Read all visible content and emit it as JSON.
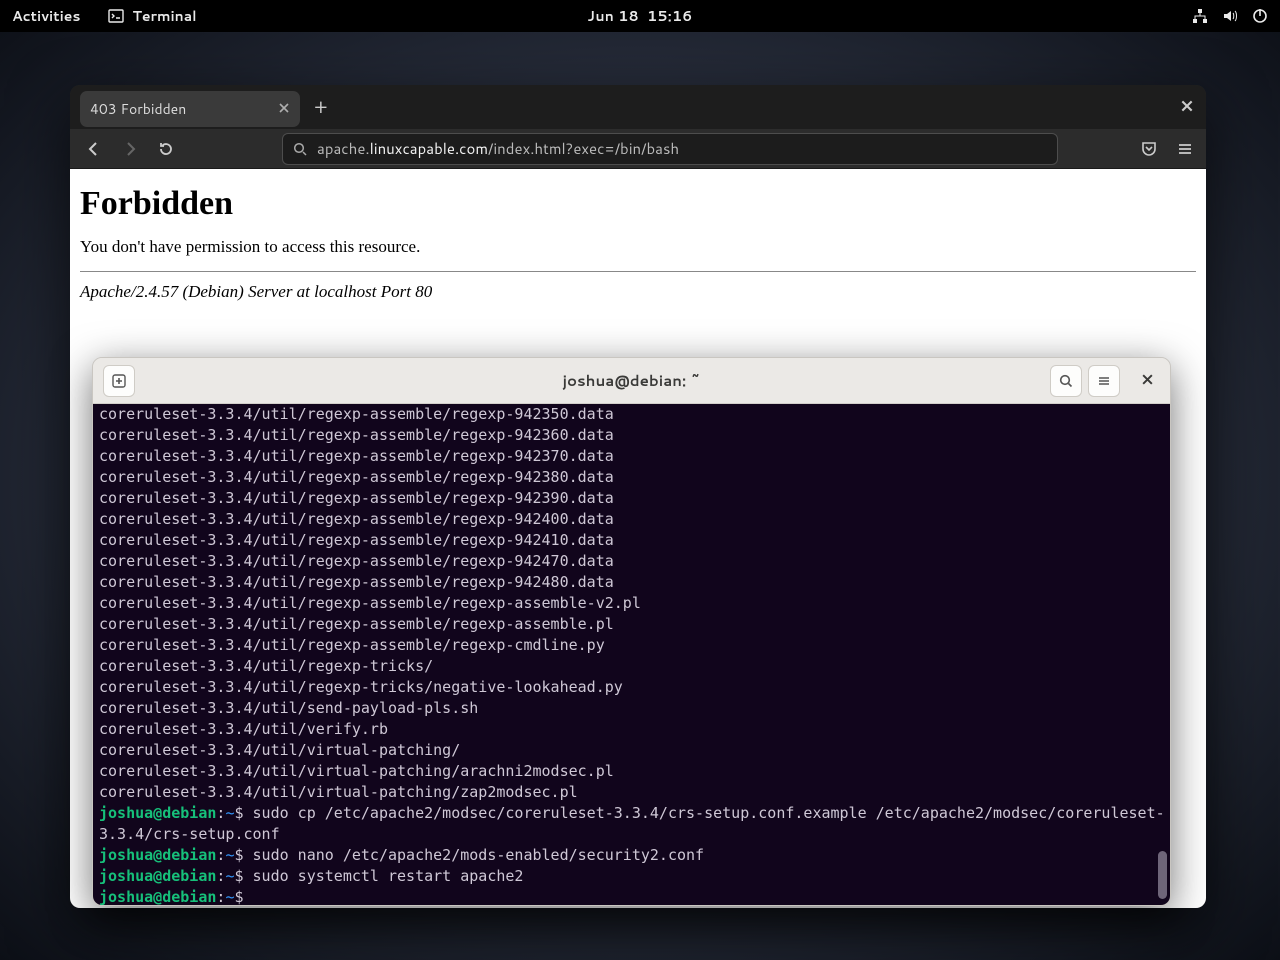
{
  "topbar": {
    "activities": "Activities",
    "app": "Terminal",
    "clock": "Jun 18  15:16"
  },
  "browser": {
    "tab_title": "403 Forbidden",
    "url_prefix": "apache.",
    "url_domain": "linuxcapable.com",
    "url_suffix": "/index.html?exec=/bin/bash",
    "page": {
      "heading": "Forbidden",
      "message": "You don't have permission to access this resource.",
      "signature": "Apache/2.4.57 (Debian) Server at localhost Port 80"
    }
  },
  "terminal": {
    "title": "joshua@debian: ~",
    "prompt_user": "joshua@debian",
    "prompt_path": "~",
    "output_lines": [
      "coreruleset-3.3.4/util/regexp-assemble/regexp-942350.data",
      "coreruleset-3.3.4/util/regexp-assemble/regexp-942360.data",
      "coreruleset-3.3.4/util/regexp-assemble/regexp-942370.data",
      "coreruleset-3.3.4/util/regexp-assemble/regexp-942380.data",
      "coreruleset-3.3.4/util/regexp-assemble/regexp-942390.data",
      "coreruleset-3.3.4/util/regexp-assemble/regexp-942400.data",
      "coreruleset-3.3.4/util/regexp-assemble/regexp-942410.data",
      "coreruleset-3.3.4/util/regexp-assemble/regexp-942470.data",
      "coreruleset-3.3.4/util/regexp-assemble/regexp-942480.data",
      "coreruleset-3.3.4/util/regexp-assemble/regexp-assemble-v2.pl",
      "coreruleset-3.3.4/util/regexp-assemble/regexp-assemble.pl",
      "coreruleset-3.3.4/util/regexp-assemble/regexp-cmdline.py",
      "coreruleset-3.3.4/util/regexp-tricks/",
      "coreruleset-3.3.4/util/regexp-tricks/negative-lookahead.py",
      "coreruleset-3.3.4/util/send-payload-pls.sh",
      "coreruleset-3.3.4/util/verify.rb",
      "coreruleset-3.3.4/util/virtual-patching/",
      "coreruleset-3.3.4/util/virtual-patching/arachni2modsec.pl",
      "coreruleset-3.3.4/util/virtual-patching/zap2modsec.pl"
    ],
    "commands": [
      "sudo cp /etc/apache2/modsec/coreruleset-3.3.4/crs-setup.conf.example /etc/apache2/modsec/coreruleset-3.3.4/crs-setup.conf",
      "sudo nano /etc/apache2/mods-enabled/security2.conf",
      "sudo systemctl restart apache2",
      ""
    ]
  }
}
